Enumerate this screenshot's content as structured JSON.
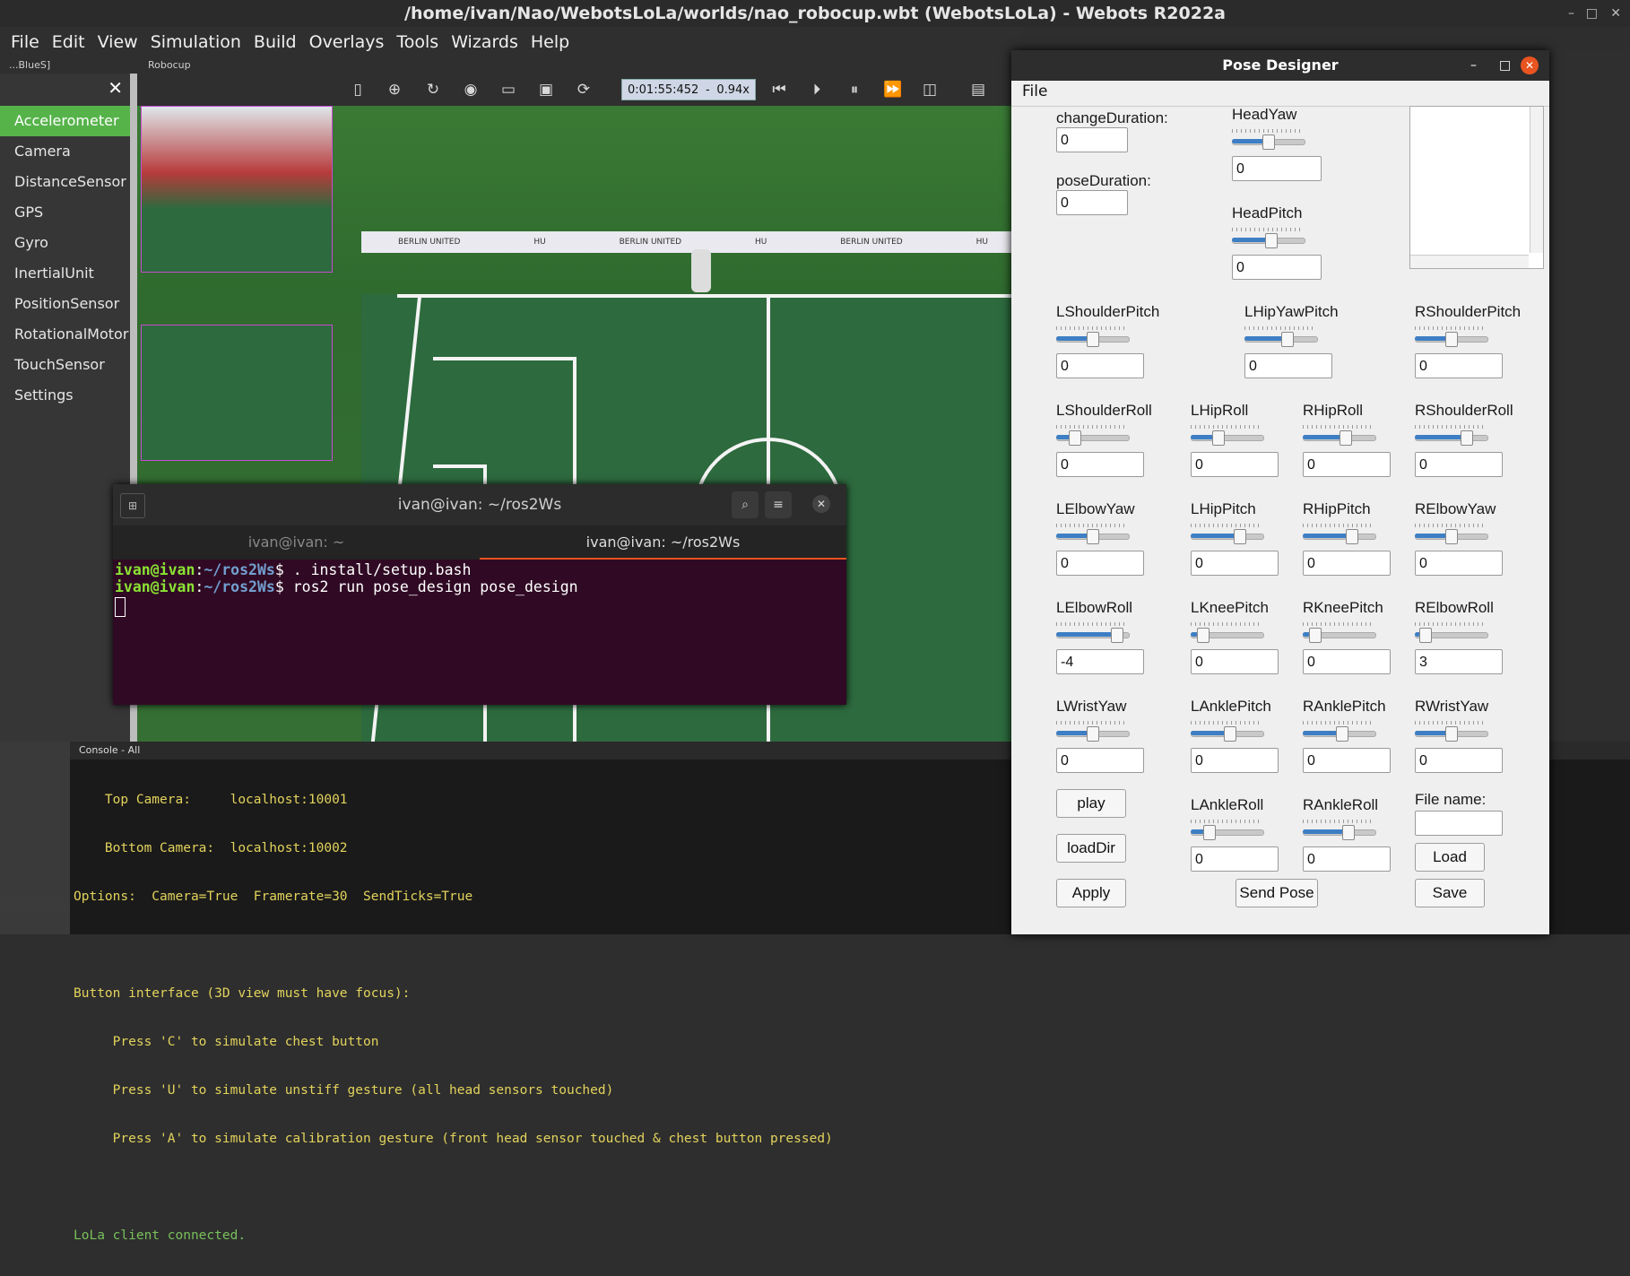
{
  "window": {
    "title": "/home/ivan/Nao/WebotsLoLa/worlds/nao_robocup.wbt (WebotsLoLa) - Webots R2022a",
    "min_icon": "–",
    "max_icon": "□",
    "close_icon": "✕"
  },
  "menu": [
    "File",
    "Edit",
    "View",
    "Simulation",
    "Build",
    "Overlays",
    "Tools",
    "Wizards",
    "Help"
  ],
  "subbar": {
    "left_label": "...BlueS]",
    "tab_label": "Robocup"
  },
  "sidebar": {
    "items": [
      "Accelerometer",
      "Camera",
      "DistanceSensor",
      "GPS",
      "Gyro",
      "InertialUnit",
      "PositionSensor",
      "RotationalMotor",
      "TouchSensor",
      "Settings"
    ],
    "active": "Accelerometer",
    "close": "✕"
  },
  "toolbar": {
    "time": "0:01:55:452",
    "dash": "-",
    "speed": "0.94x"
  },
  "terminal": {
    "title": "ivan@ivan: ~/ros2Ws",
    "tabs": [
      "ivan@ivan: ~",
      "ivan@ivan: ~/ros2Ws"
    ],
    "lines": [
      {
        "user": "ivan@ivan",
        "path": "~/ros2Ws",
        "cmd": "$ . install/setup.bash"
      },
      {
        "user": "ivan@ivan",
        "path": "~/ros2Ws",
        "cmd": "$ ros2 run pose_design pose_design"
      }
    ]
  },
  "console": {
    "title": "Console - All",
    "lines": [
      "    Top Camera:     localhost:10001",
      "    Bottom Camera:  localhost:10002",
      "Options:  Camera=True  Framerate=30  SendTicks=True",
      "",
      "Button interface (3D view must have focus):",
      "     Press 'C' to simulate chest button",
      "     Press 'U' to simulate unstiff gesture (all head sensors touched)",
      "     Press 'A' to simulate calibration gesture (front head sensor touched & chest button pressed)",
      ""
    ],
    "last_line": "LoLa client connected."
  },
  "pose_designer": {
    "title": "Pose Designer",
    "menu_file": "File",
    "change_duration": {
      "label": "changeDuration:",
      "value": "0"
    },
    "pose_duration": {
      "label": "poseDuration:",
      "value": "0"
    },
    "joints": {
      "HeadYaw": {
        "label": "HeadYaw",
        "value": "0",
        "level": 0.5
      },
      "HeadPitch": {
        "label": "HeadPitch",
        "value": "0",
        "level": 0.55
      },
      "LShoulderPitch": {
        "label": "LShoulderPitch",
        "value": "0",
        "level": 0.5
      },
      "LHipYawPitch": {
        "label": "LHipYawPitch",
        "value": "0",
        "level": 0.6
      },
      "RShoulderPitch": {
        "label": "RShoulderPitch",
        "value": "0",
        "level": 0.5
      },
      "LShoulderRoll": {
        "label": "LShoulderRoll",
        "value": "0",
        "level": 0.2
      },
      "LHipRoll": {
        "label": "LHipRoll",
        "value": "0",
        "level": 0.35
      },
      "RHipRoll": {
        "label": "RHipRoll",
        "value": "0",
        "level": 0.6
      },
      "RShoulderRoll": {
        "label": "RShoulderRoll",
        "value": "0",
        "level": 0.75
      },
      "LElbowYaw": {
        "label": "LElbowYaw",
        "value": "0",
        "level": 0.5
      },
      "LHipPitch": {
        "label": "LHipPitch",
        "value": "0",
        "level": 0.7
      },
      "RHipPitch": {
        "label": "RHipPitch",
        "value": "0",
        "level": 0.7
      },
      "RElbowYaw": {
        "label": "RElbowYaw",
        "value": "0",
        "level": 0.5
      },
      "LElbowRoll": {
        "label": "LElbowRoll",
        "value": "-4",
        "level": 0.9
      },
      "LKneePitch": {
        "label": "LKneePitch",
        "value": "0",
        "level": 0.1
      },
      "RKneePitch": {
        "label": "RKneePitch",
        "value": "0",
        "level": 0.1
      },
      "RElbowRoll": {
        "label": "RElbowRoll",
        "value": "3",
        "level": 0.08
      },
      "LWristYaw": {
        "label": "LWristYaw",
        "value": "0",
        "level": 0.5
      },
      "LAnklePitch": {
        "label": "LAnklePitch",
        "value": "0",
        "level": 0.55
      },
      "RAnklePitch": {
        "label": "RAnklePitch",
        "value": "0",
        "level": 0.55
      },
      "RWristYaw": {
        "label": "RWristYaw",
        "value": "0",
        "level": 0.5
      },
      "LAnkleRoll": {
        "label": "LAnkleRoll",
        "value": "0",
        "level": 0.2
      },
      "RAnkleRoll": {
        "label": "RAnkleRoll",
        "value": "0",
        "level": 0.65
      }
    },
    "buttons": {
      "play": "play",
      "loadDir": "loadDir",
      "apply": "Apply",
      "send_pose": "Send Pose",
      "load": "Load",
      "save": "Save"
    },
    "file_name_label": "File name:",
    "file_name_value": ""
  }
}
